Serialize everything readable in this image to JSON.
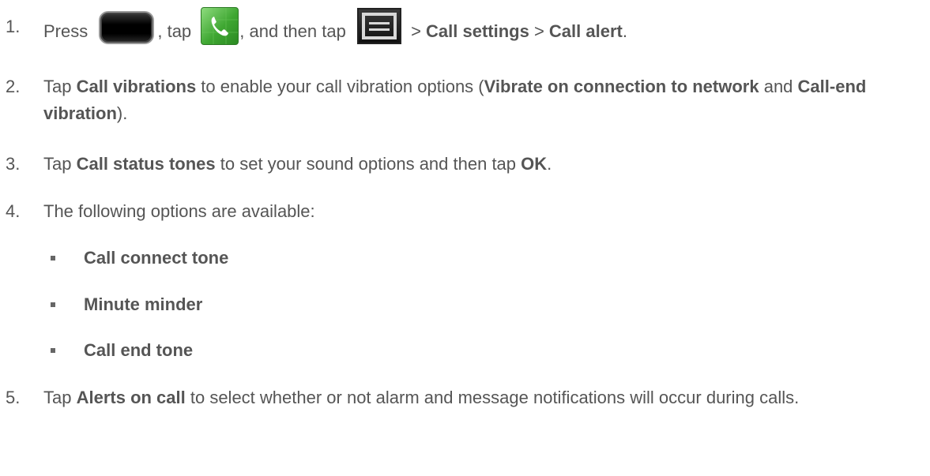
{
  "steps": [
    {
      "number": "1.",
      "parts": [
        "Press ",
        ", tap ",
        ", and then tap ",
        " > ",
        "Call settings",
        " > ",
        "Call alert",
        "."
      ]
    },
    {
      "number": "2.",
      "parts": [
        "Tap ",
        "Call vibrations",
        " to enable your call vibration options (",
        "Vibrate on connection to network",
        " and ",
        "Call-end vibration",
        ")."
      ]
    },
    {
      "number": "3.",
      "parts": [
        "Tap ",
        "Call status tones",
        " to set your sound options and then tap ",
        "OK",
        "."
      ]
    },
    {
      "number": "4.",
      "parts": [
        "The following options are available:"
      ]
    },
    {
      "number": "5.",
      "parts": [
        "Tap ",
        "Alerts on call",
        " to select whether or not alarm and message notifications will occur during calls."
      ]
    }
  ],
  "options": [
    "Call connect tone",
    "Minute minder",
    "Call end tone"
  ],
  "icons": {
    "home": "home-key-icon",
    "phone": "phone-app-icon",
    "menu": "menu-key-icon"
  },
  "colors": {
    "text": "#555555",
    "phone_green": "#3fa732"
  }
}
